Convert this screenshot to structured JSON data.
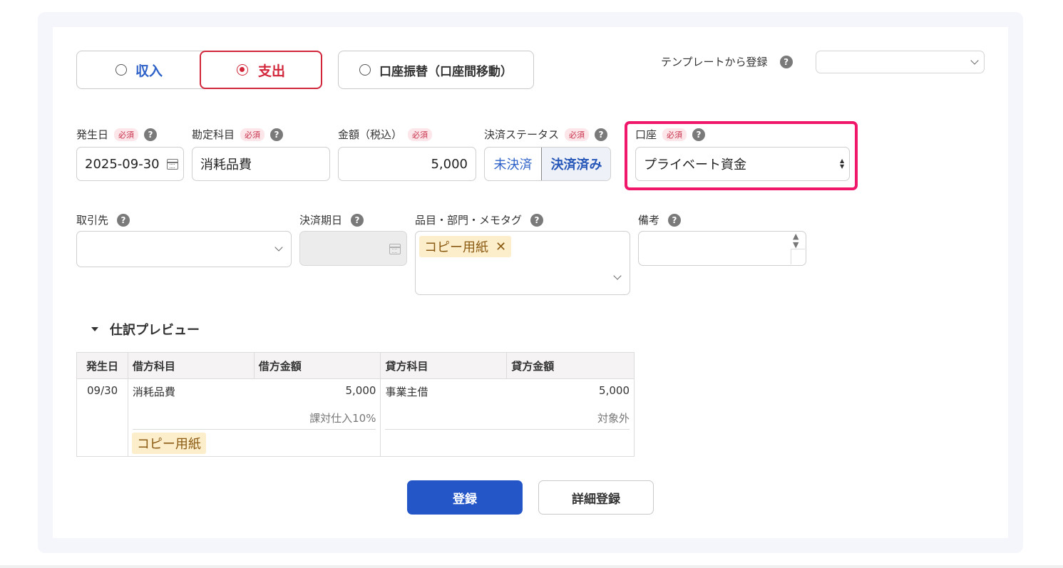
{
  "type_toggle": {
    "income_label": "収入",
    "expense_label": "支出",
    "transfer_label": "口座振替（口座間移動）",
    "selected": "支出"
  },
  "template": {
    "label": "テンプレートから登録",
    "value": ""
  },
  "help_glyph": "?",
  "required_badge": "必須",
  "fields": {
    "date": {
      "label": "発生日",
      "value": "2025-09-30"
    },
    "account_title": {
      "label": "勘定科目",
      "value": "消耗品費"
    },
    "amount": {
      "label": "金額（税込）",
      "value": "5,000"
    },
    "status": {
      "label": "決済ステータス",
      "unsettled": "未決済",
      "settled": "決済済み",
      "selected": "決済済み"
    },
    "wallet": {
      "label": "口座",
      "value": "プライベート資金"
    },
    "partner": {
      "label": "取引先",
      "value": ""
    },
    "due_date": {
      "label": "決済期日",
      "value": ""
    },
    "tags": {
      "label": "品目・部門・メモタグ",
      "items": [
        "コピー用紙"
      ],
      "remove_glyph": "✕"
    },
    "memo": {
      "label": "備考",
      "value": ""
    }
  },
  "preview": {
    "title": "仕訳プレビュー",
    "headers": [
      "発生日",
      "借方科目",
      "借方金額",
      "貸方科目",
      "貸方金額"
    ],
    "row": {
      "date": "09/30",
      "debit_account": "消耗品費",
      "debit_amount": "5,000",
      "debit_tax": "課対仕入10%",
      "debit_tag": "コピー用紙",
      "credit_account": "事業主借",
      "credit_amount": "5,000",
      "credit_tax": "対象外"
    }
  },
  "actions": {
    "register": "登録",
    "detail_register": "詳細登録"
  },
  "colors": {
    "expense_red": "#d2263b",
    "income_blue": "#2f62c8",
    "primary_button": "#2556c8",
    "highlight_pink": "#f0166a",
    "tag_bg": "#fdeecb"
  }
}
